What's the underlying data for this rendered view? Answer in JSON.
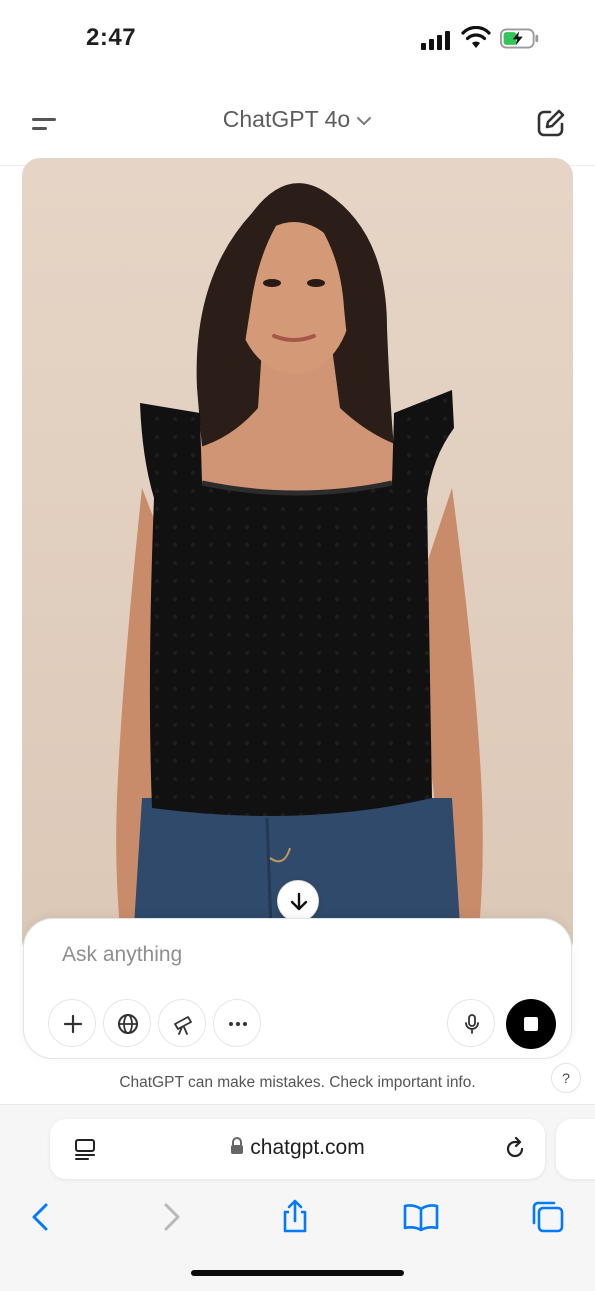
{
  "status_bar": {
    "time": "2:47"
  },
  "header": {
    "model_name": "ChatGPT 4o"
  },
  "composer": {
    "placeholder": "Ask anything"
  },
  "disclaimer": "ChatGPT can make mistakes. Check important info.",
  "help_label": "?",
  "safari": {
    "url": "chatgpt.com"
  },
  "icons": {
    "menu": "menu-icon",
    "new_chat": "edit-icon",
    "scroll_down": "arrow-down-icon",
    "add": "plus-icon",
    "search": "globe-icon",
    "research": "telescope-icon",
    "more": "more-icon",
    "voice": "mic-icon",
    "stop": "stop-icon"
  },
  "colors": {
    "accent": "#007aff",
    "background": "#ffffff",
    "photo_background": "#e4d3c3"
  }
}
